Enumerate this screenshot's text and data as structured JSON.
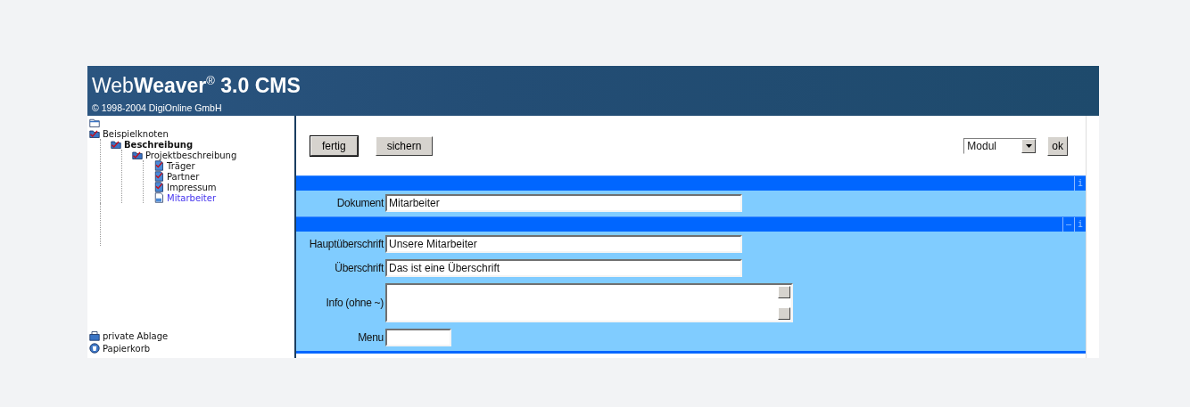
{
  "header": {
    "title": "Web**Weaver**$^{®}$ **3.0 CMS**",
    "copyright": "© 1998-2004 DigiOnline GmbH"
  },
  "tree": [
    {
      "label": "Beispielknoten",
      "kind": "folder",
      "emphasized": false,
      "selected": false,
      "children": [
        {
          "label": "Beschreibung",
          "kind": "folder",
          "emphasized": true,
          "selected": false,
          "children": [
            {
              "label": "Projektbeschreibung",
              "kind": "folder",
              "emphasized": false,
              "selected": false,
              "children": [
                {
                  "label": "Träger",
                  "kind": "checked-doc",
                  "emphasized": false,
                  "selected": false
                },
                {
                  "label": "Partner",
                  "kind": "checked-doc",
                  "emphasized": false,
                  "selected": false
                },
                {
                  "label": "Impressum",
                  "kind": "checked-doc",
                  "emphasized": false,
                  "selected": false
                },
                {
                  "label": "Mitarbeiter",
                  "kind": "doc",
                  "emphasized": false,
                  "selected": true
                }
              ]
            }
          ]
        }
      ]
    }
  ],
  "sidebar_bottom": [
    {
      "label": "private Ablage",
      "kind": "box"
    },
    {
      "label": "Papierkorb",
      "kind": "bin"
    }
  ],
  "toolbar": {
    "buttons": [
      {
        "label": "fertig",
        "selected": true
      },
      {
        "label": "sichern",
        "selected": false
      }
    ],
    "select": {
      "value": "Modul"
    },
    "ok": "ok"
  },
  "sections": [
    {
      "bar_controls": [
        "i"
      ],
      "fields": [
        {
          "label": "Dokument",
          "value": "Mitarbeiter",
          "kind": "text"
        }
      ]
    },
    {
      "bar_controls": [
        "—",
        "i"
      ],
      "fields": [
        {
          "label": "Hauptüberschrift",
          "value": "Unsere Mitarbeiter",
          "kind": "text"
        },
        {
          "label": "Überschrift",
          "value": "Das ist eine Überschrift",
          "kind": "text"
        },
        {
          "label": "Info (ohne ~)",
          "kind": "textarea"
        },
        {
          "label": "Menu",
          "kind": "short"
        }
      ]
    }
  ]
}
